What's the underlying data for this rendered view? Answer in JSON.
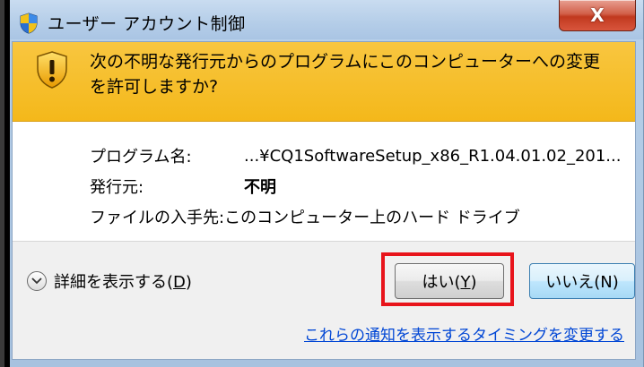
{
  "window": {
    "title": "ユーザー アカウント制御",
    "close_label": "X"
  },
  "banner": {
    "question": "次の不明な発行元からのプログラムにこのコンピューターへの変更を許可しますか?"
  },
  "details": {
    "program_label": "プログラム名:",
    "program_value": "...¥CQ1SoftwareSetup_x86_R1.04.01.02_201...",
    "publisher_label": "発行元:",
    "publisher_value": "不明",
    "origin_label": "ファイルの入手先:",
    "origin_value": "このコンピューター上のハード ドライブ"
  },
  "footer": {
    "show_details_prefix": "詳細を表示する(",
    "show_details_key": "D",
    "show_details_suffix": ")",
    "yes_prefix": "はい(",
    "yes_key": "Y",
    "yes_suffix": ")",
    "no_label": "いいえ(N)",
    "notification_link": "これらの通知を表示するタイミングを変更する"
  },
  "colors": {
    "banner": "#f4b81a",
    "highlight": "#e8141b",
    "link": "#0046d5",
    "close": "#c1391f"
  },
  "icons": {
    "title": "uac-shield-icon",
    "banner": "warning-shield-icon",
    "expander": "chevron-down-icon"
  }
}
